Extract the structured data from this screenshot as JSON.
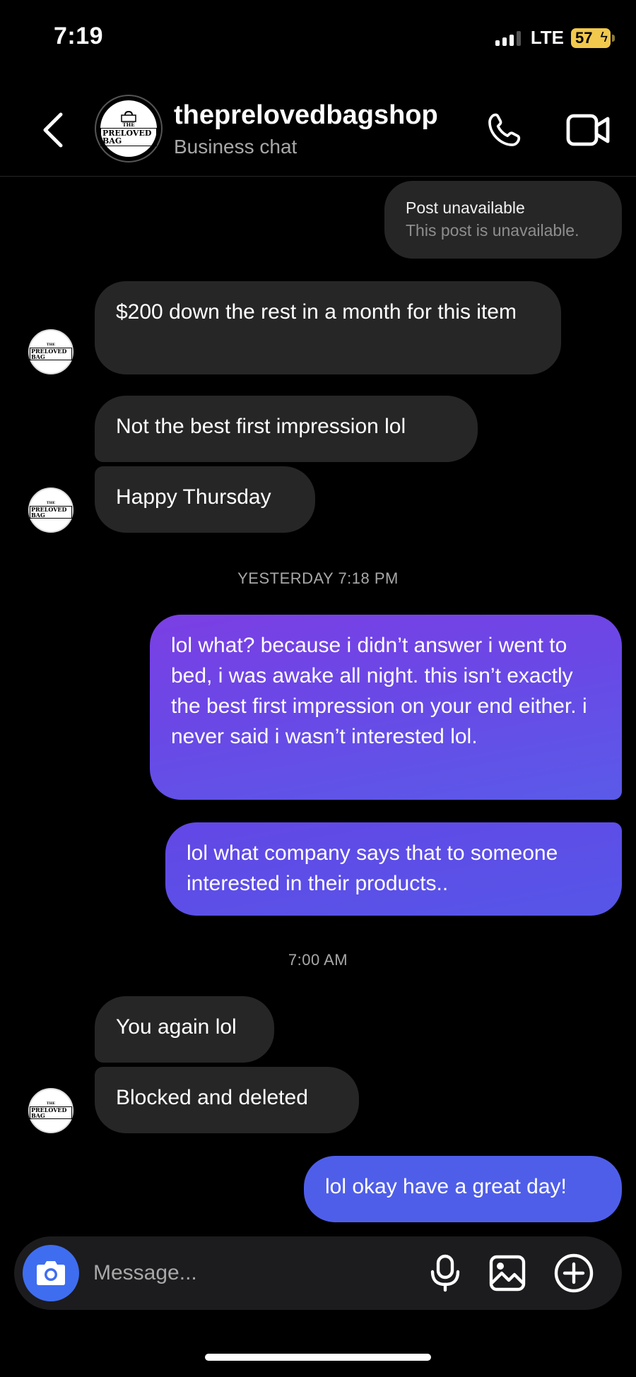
{
  "status_bar": {
    "time": "7:19",
    "network": "LTE",
    "battery": "57"
  },
  "header": {
    "shop_name": "thepreloved bagshop",
    "shop_name_display": "theprelovedbagshop",
    "subtitle": "Business chat",
    "logo_line1": "THE",
    "logo_line2": "PRELOVED BAG"
  },
  "shared_post": {
    "title": "Post unavailable",
    "description": "This post is unavailable."
  },
  "messages": [
    {
      "from": "shop",
      "text": "$200 down the rest in a month for this item"
    },
    {
      "from": "shop",
      "text": "Not the best first impression lol"
    },
    {
      "from": "shop",
      "text": "Happy Thursday"
    },
    {
      "from": "me",
      "text": "lol what? because i didn’t answer i went to bed, i was awake all night. this isn’t exactly the best first impression on your end either. i never said i wasn’t interested lol."
    },
    {
      "from": "me",
      "text": "lol what company says that to someone interested in their products.."
    },
    {
      "from": "shop",
      "text": "You again lol"
    },
    {
      "from": "shop",
      "text": "Blocked and deleted"
    },
    {
      "from": "me",
      "text": "lol okay have a great day!"
    }
  ],
  "timestamps": {
    "first": "YESTERDAY 7:18 PM",
    "second": "7:00 AM"
  },
  "composer": {
    "placeholder": "Message..."
  },
  "icons": {
    "back": "chevron-left-icon",
    "call": "phone-icon",
    "video": "video-camera-icon",
    "camera": "camera-icon",
    "mic": "microphone-icon",
    "gallery": "image-icon",
    "plus": "plus-circle-icon"
  },
  "colors": {
    "background": "#000000",
    "incoming_bubble": "#262626",
    "outgoing_gradient_start": "#7b3fe4",
    "outgoing_gradient_end": "#4f5ee9",
    "camera_button": "#3f6df0",
    "battery": "#f2c94c"
  }
}
